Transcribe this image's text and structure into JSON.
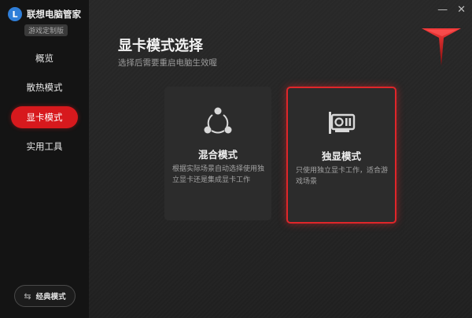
{
  "app": {
    "name": "联想电脑管家",
    "edition": "游戏定制版",
    "logo_letter": "L"
  },
  "sidebar": {
    "items": [
      {
        "label": "概览",
        "active": false
      },
      {
        "label": "散热模式",
        "active": false
      },
      {
        "label": "显卡模式",
        "active": true
      },
      {
        "label": "实用工具",
        "active": false
      }
    ],
    "classic_mode_label": "经典模式",
    "swap_glyph": "⇆"
  },
  "window": {
    "minimize_glyph": "—",
    "close_glyph": "✕"
  },
  "main": {
    "title": "显卡模式选择",
    "subtitle": "选择后需要重启电脑生效喔",
    "cards": [
      {
        "title": "混合模式",
        "desc": "根据实际场景自动选择使用独立显卡还是集成显卡工作",
        "icon": "share-nodes-icon",
        "selected": false
      },
      {
        "title": "独显模式",
        "desc": "只使用独立显卡工作，适合游戏场景",
        "icon": "graphics-card-icon",
        "selected": true
      }
    ]
  },
  "colors": {
    "accent": "#d7191d",
    "sidebar_bg": "#141414",
    "main_bg": "#262626",
    "card_bg": "#2c2c2c"
  }
}
